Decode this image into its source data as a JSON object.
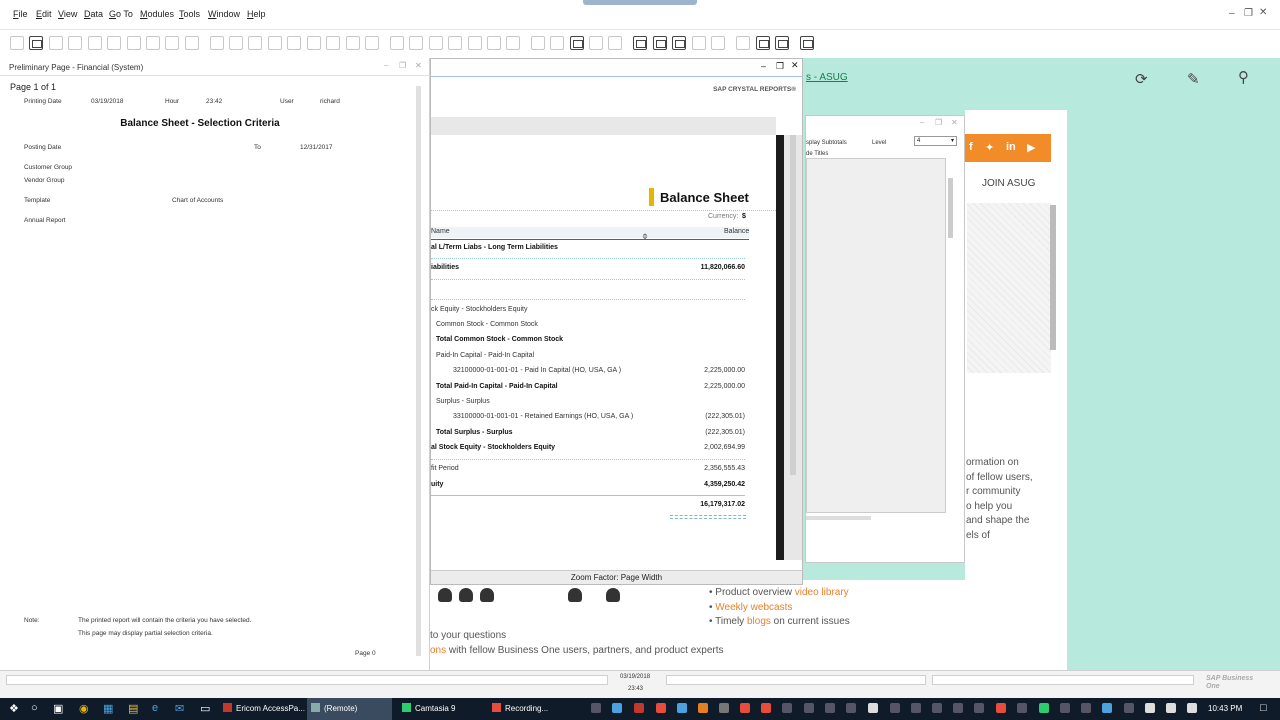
{
  "menubar": {
    "items": [
      {
        "label": "File",
        "u": "F",
        "rest": "ile"
      },
      {
        "label": "Edit",
        "u": "E",
        "rest": "dit"
      },
      {
        "label": "View",
        "u": "V",
        "rest": "iew"
      },
      {
        "label": "Data",
        "u": "D",
        "rest": "ata"
      },
      {
        "label": "Go To",
        "u": "G",
        "rest": "o To"
      },
      {
        "label": "Modules",
        "u": "M",
        "rest": "odules"
      },
      {
        "label": "Tools",
        "u": "T",
        "rest": "ools"
      },
      {
        "label": "Window",
        "u": "W",
        "rest": "indow"
      },
      {
        "label": "Help",
        "u": "H",
        "rest": "elp"
      }
    ]
  },
  "prelim": {
    "title": "Preliminary Page - Financial (System)",
    "pager": "Page 1 of 1",
    "printing_date_label": "Printing Date",
    "printing_date": "03/19/2018",
    "hour_label": "Hour",
    "hour": "23:42",
    "user_label": "User",
    "user": "richard",
    "heading": "Balance Sheet - Selection Criteria",
    "posting_date_label": "Posting Date",
    "to_label": "To",
    "to_date": "12/31/2017",
    "customer_group_label": "Customer Group",
    "vendor_group_label": "Vendor Group",
    "template_label": "Template",
    "template_value": "Chart of Accounts",
    "annual_report_label": "Annual Report",
    "note_label": "Note:",
    "note_line1": "The printed report will contain the criteria you have selected.",
    "note_line2": "This page may display partial selection criteria.",
    "page_footer": "Page 0"
  },
  "crystal": {
    "brand": "SAP CRYSTAL REPORTS®",
    "report_title": "Balance Sheet",
    "currency_label": "Currency:",
    "currency_symbol": "$",
    "col_name": "Name",
    "col_balance": "Balance",
    "zoom": "Zoom Factor: Page Width",
    "rows": [
      {
        "label": "al L/Term Liabs - Long Term Liabilities",
        "value": "",
        "bold": true
      },
      {
        "label": "iabilities",
        "value": "11,820,066.60",
        "bold": true
      },
      {
        "label": "ck Equity - Stockholders Equity",
        "value": "",
        "bold": false
      },
      {
        "label": "Common Stock - Common Stock",
        "value": "",
        "bold": false
      },
      {
        "label": "Total Common Stock - Common Stock",
        "value": "",
        "bold": true
      },
      {
        "label": "Paid-In Capital - Paid-In Capital",
        "value": "",
        "bold": false
      },
      {
        "label": "32100000-01-001-01 - Paid In Capital (HO, USA, GA )",
        "value": "2,225,000.00",
        "bold": false
      },
      {
        "label": "Total Paid-In Capital - Paid-In Capital",
        "value": "2,225,000.00",
        "bold": true
      },
      {
        "label": "Surplus - Surplus",
        "value": "",
        "bold": false
      },
      {
        "label": "33100000-01-001-01 - Retained Earnings (HO, USA, GA )",
        "value": "(222,305.01)",
        "bold": false
      },
      {
        "label": "Total Surplus - Surplus",
        "value": "(222,305.01)",
        "bold": true
      },
      {
        "label": "al Stock Equity - Stockholders Equity",
        "value": "2,002,694.99",
        "bold": true
      },
      {
        "label": "fit Period",
        "value": "2,356,555.43",
        "bold": false
      },
      {
        "label": "uity",
        "value": "4,359,250.42",
        "bold": true
      },
      {
        "label": "",
        "value": "16,179,317.02",
        "bold": true
      }
    ]
  },
  "seldlg": {
    "display_subtotals": "splay Subtotals",
    "level_label": "Level",
    "level_value": "4",
    "hide_titles": "de Titles"
  },
  "browser": {
    "asug_link": "s - ASUG",
    "join": "JOIN ASUG",
    "para": [
      "ormation on",
      "of fellow users,",
      "r community",
      "o help you",
      "and shape the",
      "els of"
    ],
    "list": [
      {
        "pre": "Product overview ",
        "hl": "video library",
        "post": ""
      },
      {
        "pre": "",
        "hl": "Weekly webcasts",
        "post": ""
      },
      {
        "pre": "Timely ",
        "hl": "blogs",
        "post": " on current issues"
      }
    ],
    "line1": "to your questions",
    "line2_hl": "ons",
    "line2_rest": " with fellow Business One users, partners, and product experts"
  },
  "statusbar": {
    "date": "03/19/2018",
    "time": "23:43",
    "logo": "SAP Business One"
  },
  "taskbar": {
    "tasks": [
      "Ericom AccessPa...",
      "(Remote)",
      "Camtasia 9",
      "Recording..."
    ],
    "clock": "10:43 PM"
  },
  "colors": {
    "accent_blue": "#9ec1e4",
    "browser_bg": "#b7eadd",
    "asug_orange": "#f28c28",
    "report_marker": "#e8b400",
    "taskbar": "#101b2a"
  }
}
